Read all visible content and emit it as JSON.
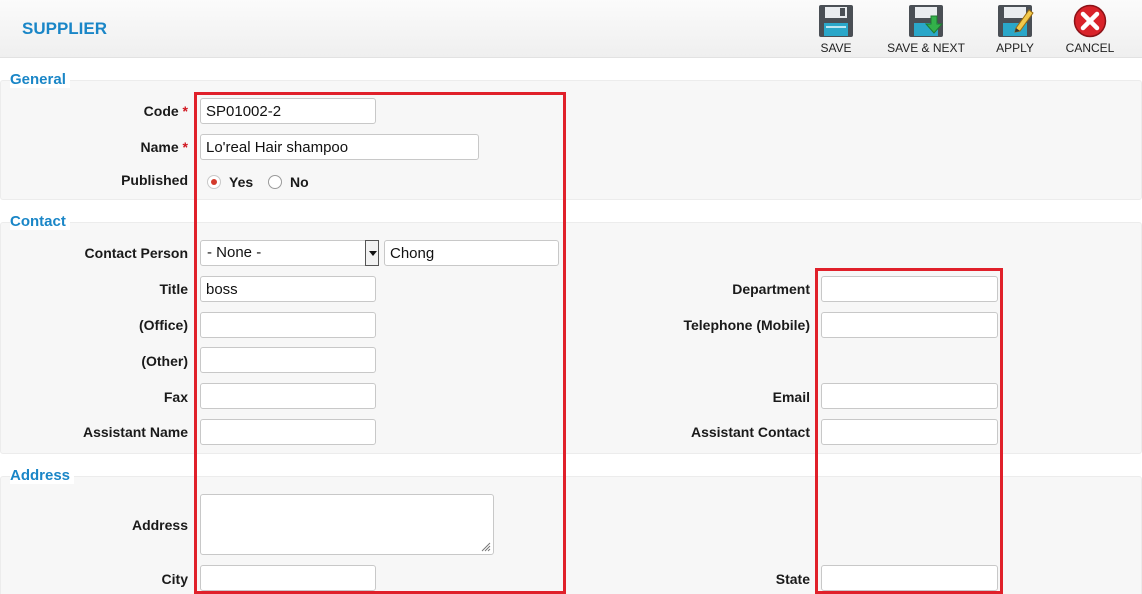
{
  "header": {
    "title": "SUPPLIER",
    "toolbar": [
      {
        "label": "SAVE",
        "icon": "save-icon"
      },
      {
        "label": "SAVE & NEXT",
        "icon": "save-next-icon"
      },
      {
        "label": "APPLY",
        "icon": "apply-icon"
      },
      {
        "label": "CANCEL",
        "icon": "cancel-icon"
      }
    ]
  },
  "general": {
    "legend": "General",
    "code_label": "Code",
    "code_value": "SP01002-2",
    "name_label": "Name",
    "name_value": "Lo'real Hair shampoo",
    "required_mark": "*",
    "published_label": "Published",
    "published_yes": "Yes",
    "published_no": "No",
    "published_selected": "Yes"
  },
  "contact": {
    "legend": "Contact",
    "contact_person_label": "Contact Person",
    "contact_person_select": "- None -",
    "contact_person_value": "Chong",
    "title_label": "Title",
    "title_value": "boss",
    "office_label": "(Office)",
    "office_value": "",
    "other_label": "(Other)",
    "other_value": "",
    "fax_label": "Fax",
    "fax_value": "",
    "assistant_name_label": "Assistant Name",
    "assistant_name_value": "",
    "department_label": "Department",
    "department_value": "",
    "mobile_label": "Telephone (Mobile)",
    "mobile_value": "",
    "email_label": "Email",
    "email_value": "",
    "assistant_contact_label": "Assistant Contact",
    "assistant_contact_value": ""
  },
  "address": {
    "legend": "Address",
    "address_label": "Address",
    "address_value": "",
    "city_label": "City",
    "city_value": "",
    "state_label": "State",
    "state_value": ""
  },
  "colors": {
    "accent": "#1a86c7",
    "required": "#d0161f",
    "highlight": "#e0202a",
    "radio_selected": "#d33a2c"
  }
}
